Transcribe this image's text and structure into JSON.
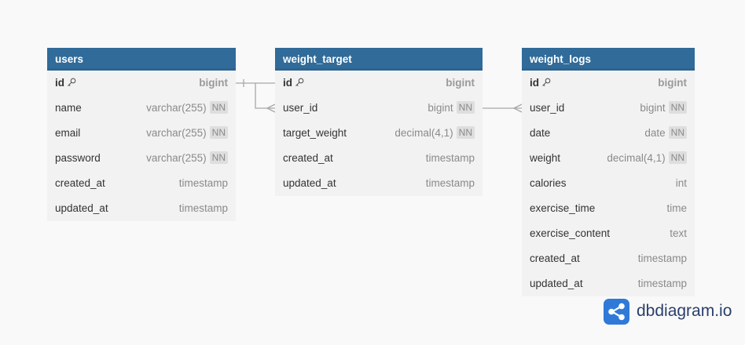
{
  "tables": [
    {
      "name": "users",
      "fields": [
        {
          "name": "id",
          "type": "bigint",
          "pk": true,
          "nn": false
        },
        {
          "name": "name",
          "type": "varchar(255)",
          "pk": false,
          "nn": true
        },
        {
          "name": "email",
          "type": "varchar(255)",
          "pk": false,
          "nn": true
        },
        {
          "name": "password",
          "type": "varchar(255)",
          "pk": false,
          "nn": true
        },
        {
          "name": "created_at",
          "type": "timestamp",
          "pk": false,
          "nn": false
        },
        {
          "name": "updated_at",
          "type": "timestamp",
          "pk": false,
          "nn": false
        }
      ]
    },
    {
      "name": "weight_target",
      "fields": [
        {
          "name": "id",
          "type": "bigint",
          "pk": true,
          "nn": false
        },
        {
          "name": "user_id",
          "type": "bigint",
          "pk": false,
          "nn": true
        },
        {
          "name": "target_weight",
          "type": "decimal(4,1)",
          "pk": false,
          "nn": true
        },
        {
          "name": "created_at",
          "type": "timestamp",
          "pk": false,
          "nn": false
        },
        {
          "name": "updated_at",
          "type": "timestamp",
          "pk": false,
          "nn": false
        }
      ]
    },
    {
      "name": "weight_logs",
      "fields": [
        {
          "name": "id",
          "type": "bigint",
          "pk": true,
          "nn": false
        },
        {
          "name": "user_id",
          "type": "bigint",
          "pk": false,
          "nn": true
        },
        {
          "name": "date",
          "type": "date",
          "pk": false,
          "nn": true
        },
        {
          "name": "weight",
          "type": "decimal(4,1)",
          "pk": false,
          "nn": true
        },
        {
          "name": "calories",
          "type": "int",
          "pk": false,
          "nn": false
        },
        {
          "name": "exercise_time",
          "type": "time",
          "pk": false,
          "nn": false
        },
        {
          "name": "exercise_content",
          "type": "text",
          "pk": false,
          "nn": false
        },
        {
          "name": "created_at",
          "type": "timestamp",
          "pk": false,
          "nn": false
        },
        {
          "name": "updated_at",
          "type": "timestamp",
          "pk": false,
          "nn": false
        }
      ]
    }
  ],
  "nn_label": "NN",
  "relationships": [
    {
      "from": "users.id",
      "to": "weight_target.user_id",
      "cardinality": "one-to-many"
    },
    {
      "from": "weight_target.id",
      "to": "weight_logs.user_id",
      "cardinality": "one-to-many"
    }
  ],
  "brand": {
    "name": "dbdiagram.io",
    "header_color": "#306b99",
    "logo_color": "#2f7ad8"
  },
  "icons": {
    "primary_key": "key-icon",
    "logo": "share-nodes-icon"
  }
}
